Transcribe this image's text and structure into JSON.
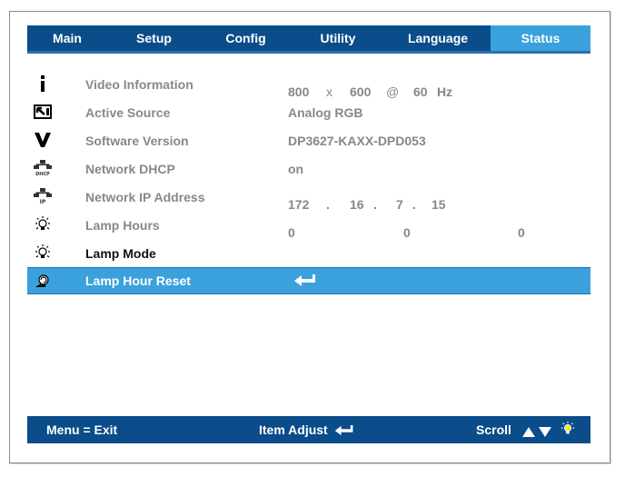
{
  "tabs": [
    {
      "label": "Main"
    },
    {
      "label": "Setup"
    },
    {
      "label": "Config"
    },
    {
      "label": "Utility"
    },
    {
      "label": "Language"
    },
    {
      "label": "Status",
      "active": true
    }
  ],
  "rows": [
    {
      "icon": "info-icon",
      "label": "Video Information",
      "value": {
        "width": "800",
        "x": "x",
        "height": "600",
        "at": "@",
        "rate": "60",
        "unit": "Hz"
      }
    },
    {
      "icon": "source-icon",
      "label": "Active Source",
      "value": "Analog RGB"
    },
    {
      "icon": "version-icon",
      "label": "Software Version",
      "value": "DP3627-KAXX-DPD053"
    },
    {
      "icon": "network-dhcp-icon",
      "label": "Network DHCP",
      "value": "on"
    },
    {
      "icon": "network-ip-icon",
      "label": "Network IP Address",
      "value": {
        "o1": "172",
        "d1": ".",
        "o2": "16",
        "d2": ".",
        "o3": "7",
        "d3": ".",
        "o4": "15"
      }
    },
    {
      "icon": "lamp-icon",
      "label": "Lamp Hours",
      "value": {
        "a": "0",
        "b": "0",
        "c": "0"
      }
    },
    {
      "icon": "lamp-icon",
      "label": "Lamp Mode",
      "value": ""
    },
    {
      "icon": "lamp-reset-icon",
      "label": "Lamp Hour Reset",
      "value": "enter-icon",
      "selected": true
    }
  ],
  "footer": {
    "exit": "Menu = Exit",
    "adjust": "Item Adjust",
    "scroll": "Scroll"
  },
  "colors": {
    "bar": "#0b4c8a",
    "highlight": "#3aa1dd"
  }
}
